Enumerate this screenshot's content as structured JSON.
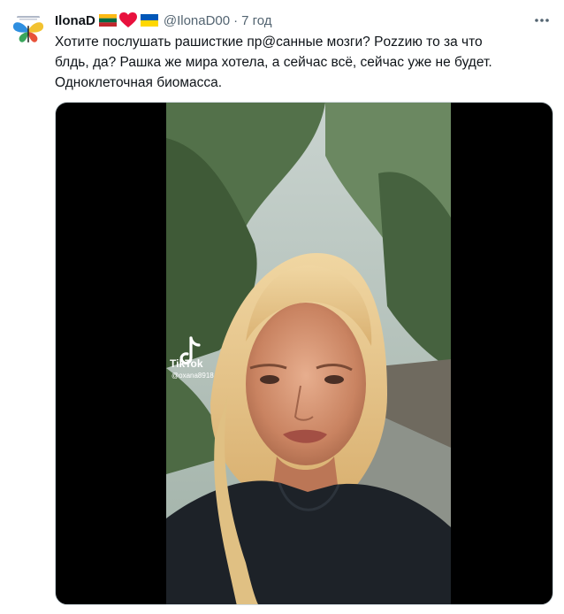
{
  "tweet": {
    "display_name": "IlonaD",
    "handle": "@IlonaD00",
    "separator": "·",
    "time": "7 год",
    "text": "Хотите послушать рашисткие пр@санные мозги? Pozzию то за что\nблдь, да? Рашка же мира хотела, а сейчас всё, сейчас уже не будет.\nОдноклеточная биомасса.",
    "name_flags": [
      "lithuania-flag",
      "heart",
      "ukraine-flag"
    ]
  },
  "video": {
    "watermark_app": "TikTok",
    "watermark_user": "@oxana8918"
  },
  "colors": {
    "text_primary": "#0f1419",
    "text_secondary": "#536471",
    "heart": "#e8113d",
    "flag_lt": [
      "#fdb913",
      "#006a44",
      "#c1272d"
    ],
    "flag_ua": [
      "#0057b7",
      "#ffd700"
    ]
  }
}
